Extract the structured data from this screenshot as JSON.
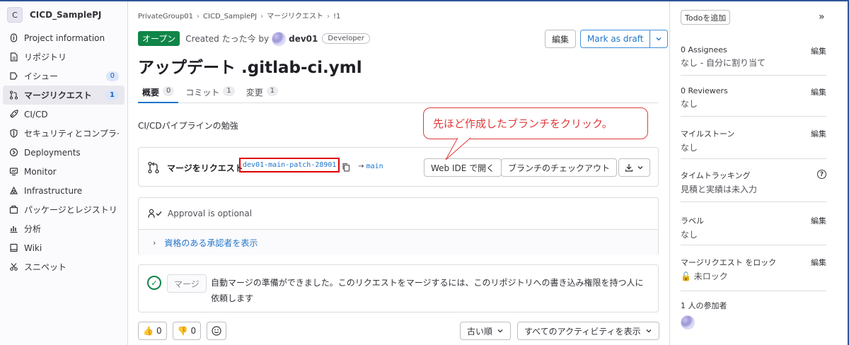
{
  "project": {
    "avatar_letter": "C",
    "name": "CICD_SamplePJ"
  },
  "sidebar": {
    "items": [
      {
        "label": "Project information",
        "icon": "info-icon"
      },
      {
        "label": "リポジトリ",
        "icon": "document-icon"
      },
      {
        "label": "イシュー",
        "icon": "issues-icon",
        "count": "0"
      },
      {
        "label": "マージリクエスト",
        "icon": "merge-request-icon",
        "count": "1",
        "active": true
      },
      {
        "label": "CI/CD",
        "icon": "rocket-icon"
      },
      {
        "label": "セキュリティとコンプライアンス",
        "icon": "shield-icon"
      },
      {
        "label": "Deployments",
        "icon": "deployments-icon"
      },
      {
        "label": "Monitor",
        "icon": "monitor-icon"
      },
      {
        "label": "Infrastructure",
        "icon": "cloud-icon"
      },
      {
        "label": "パッケージとレジストリ",
        "icon": "package-icon"
      },
      {
        "label": "分析",
        "icon": "chart-icon"
      },
      {
        "label": "Wiki",
        "icon": "book-icon"
      },
      {
        "label": "スニペット",
        "icon": "snippet-icon"
      }
    ]
  },
  "breadcrumb": [
    "PrivateGroup01",
    "CICD_SamplePJ",
    "マージリクエスト",
    "!1"
  ],
  "mr": {
    "status": "オープン",
    "created_prefix": "Created たった今 by",
    "author": "dev01",
    "role": "Developer",
    "edit_label": "編集",
    "draft_label": "Mark as draft",
    "title": "アップデート .gitlab-ci.yml",
    "description": "CI/CDパイプラインの勉強"
  },
  "tabs": [
    {
      "label": "概要",
      "count": "0",
      "active": true
    },
    {
      "label": "コミット",
      "count": "1"
    },
    {
      "label": "変更",
      "count": "1"
    }
  ],
  "callout": {
    "text": "先ほど作成したブランチをクリック。"
  },
  "merge_widget": {
    "label": "マージをリクエスト",
    "source_branch": "dev01-main-patch-28901",
    "arrow": "→",
    "target_branch": "main",
    "web_ide_label": "Web IDE で開く",
    "checkout_label": "ブランチのチェックアウト"
  },
  "approval": {
    "text": "Approval is optional",
    "approvers_link": "資格のある承認者を表示"
  },
  "auto_merge": {
    "button_label": "マージ",
    "message": "自動マージの準備ができました。このリクエストをマージするには、このリポジトリへの書き込み権限を持つ人に依頼します"
  },
  "reactions": {
    "thumbs_up": "0",
    "thumbs_down": "0"
  },
  "activity": {
    "sort_label": "古い順",
    "filter_label": "すべてのアクティビティを表示"
  },
  "right_sidebar": {
    "todo_label": "Todoを追加",
    "assignees": {
      "title": "0 Assignees",
      "value": "なし - 自分に割り当て",
      "edit": "編集"
    },
    "reviewers": {
      "title": "0 Reviewers",
      "value": "なし",
      "edit": "編集"
    },
    "milestone": {
      "title": "マイルストーン",
      "value": "なし",
      "edit": "編集"
    },
    "time_tracking": {
      "title": "タイムトラッキング",
      "value": "見積と実績は未入力"
    },
    "labels": {
      "title": "ラベル",
      "value": "なし",
      "edit": "編集"
    },
    "lock": {
      "title": "マージリクエスト をロック",
      "value": "未ロック",
      "edit": "編集"
    },
    "participants": {
      "title": "1 人の参加者"
    }
  },
  "colors": {
    "open_badge": "#108548",
    "accent": "#1f75cb",
    "callout": "#e03a3a",
    "highlight_box": "#e00000"
  }
}
